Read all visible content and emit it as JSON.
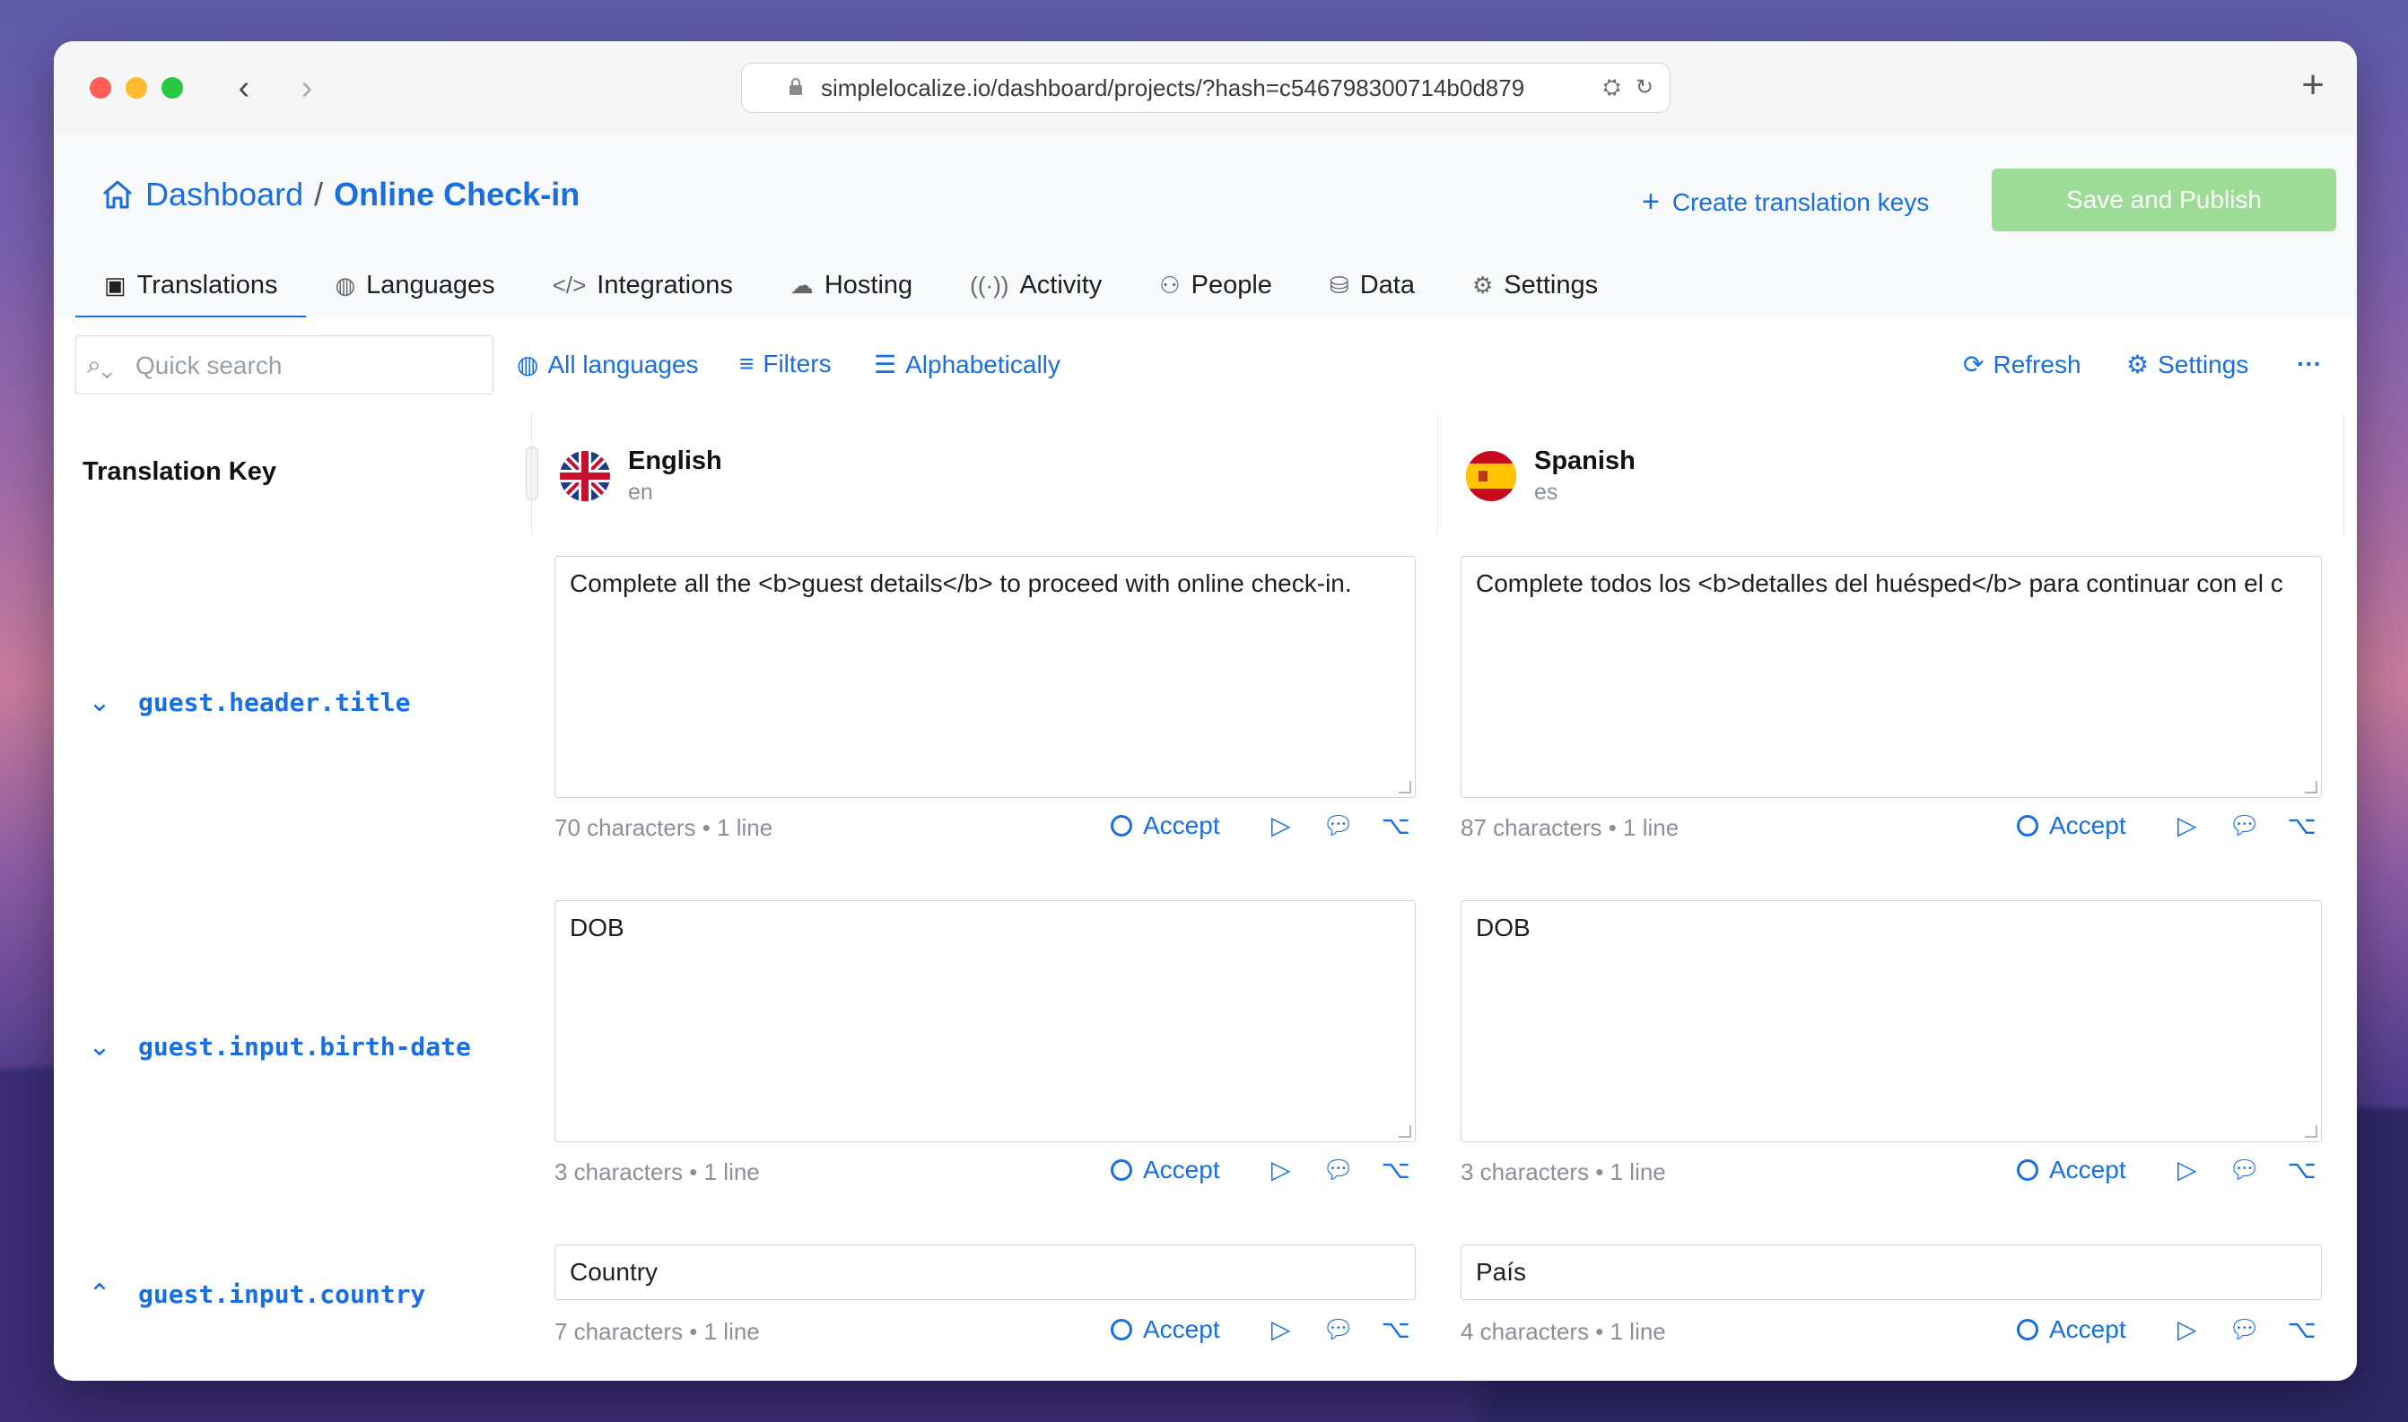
{
  "browser": {
    "url": "simplelocalize.io/dashboard/projects/?hash=c546798300714b0d879"
  },
  "breadcrumb": {
    "home": "Dashboard",
    "separator": "/",
    "current": "Online Check-in"
  },
  "header": {
    "create_label": "Create translation keys",
    "save_label": "Save and Publish"
  },
  "tabs": [
    {
      "label": "Translations",
      "icon": "translate-icon"
    },
    {
      "label": "Languages",
      "icon": "globe-icon"
    },
    {
      "label": "Integrations",
      "icon": "code-icon"
    },
    {
      "label": "Hosting",
      "icon": "cloud-icon"
    },
    {
      "label": "Activity",
      "icon": "broadcast-icon"
    },
    {
      "label": "People",
      "icon": "people-icon"
    },
    {
      "label": "Data",
      "icon": "database-icon"
    },
    {
      "label": "Settings",
      "icon": "gear-icon"
    }
  ],
  "filters": {
    "search_placeholder": "Quick search",
    "all_languages": "All languages",
    "filters": "Filters",
    "sort": "Alphabetically",
    "refresh": "Refresh",
    "settings": "Settings"
  },
  "table": {
    "key_header": "Translation Key",
    "languages": [
      {
        "name": "English",
        "code": "en"
      },
      {
        "name": "Spanish",
        "code": "es"
      }
    ],
    "accept_label": "Accept",
    "rows": [
      {
        "key": "guest.header.title",
        "en": "Complete all the <b>guest details</b> to proceed with online check-in.",
        "en_meta": "70 characters • 1 line",
        "es": "Complete todos los <b>detalles del huésped</b> para continuar con el c",
        "es_meta": "87 characters • 1 line"
      },
      {
        "key": "guest.input.birth-date",
        "en": "DOB",
        "en_meta": "3 characters • 1 line",
        "es": "DOB",
        "es_meta": "3 characters • 1 line"
      },
      {
        "key": "guest.input.country",
        "en": "Country",
        "en_meta": "7 characters • 1 line",
        "es": "País",
        "es_meta": "4 characters • 1 line"
      }
    ]
  }
}
